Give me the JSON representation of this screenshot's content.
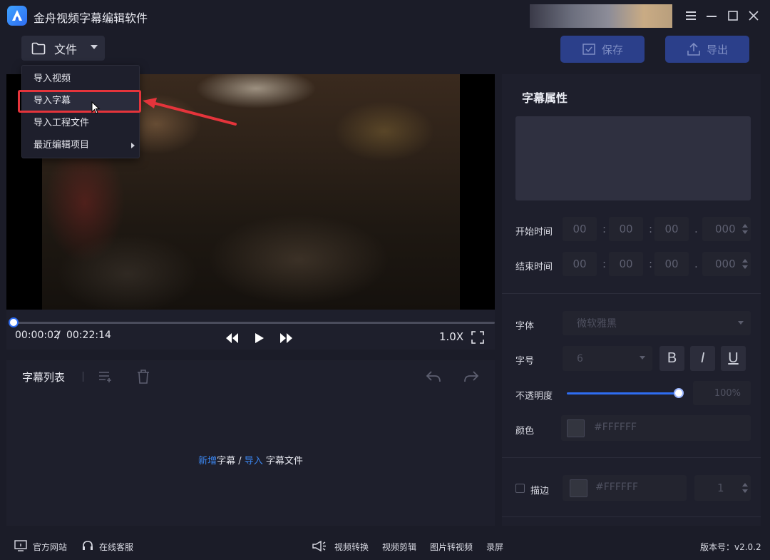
{
  "window": {
    "title": "金舟视频字幕编辑软件",
    "controls": [
      "menu-icon",
      "minimize-icon",
      "maximize-icon",
      "close-icon"
    ]
  },
  "toolbar": {
    "file_label": "文件",
    "save_label": "保存",
    "export_label": "导出"
  },
  "file_menu": {
    "items": [
      {
        "label": "导入视频"
      },
      {
        "label": "导入字幕",
        "highlighted": true
      },
      {
        "label": "导入工程文件"
      },
      {
        "label": "最近编辑项目",
        "has_submenu": true
      }
    ]
  },
  "player": {
    "current_time": "00:00:02",
    "separator": "/",
    "total_time": "00:22:14",
    "speed": "1.0X",
    "progress": 0.0
  },
  "subtitle_list": {
    "title": "字幕列表",
    "empty_hint": {
      "add_link": "新增",
      "add_text": "字幕 / ",
      "import_link": "导入",
      "import_text": " 字幕文件"
    }
  },
  "properties": {
    "title": "字幕属性",
    "start_label": "开始时间",
    "end_label": "结束时间",
    "start_time": {
      "h": "00",
      "m": "00",
      "s": "00",
      "ms": "000"
    },
    "end_time": {
      "h": "00",
      "m": "00",
      "s": "00",
      "ms": "000"
    },
    "font_label": "字体",
    "font_value": "微软雅黑",
    "size_label": "字号",
    "size_value": "6",
    "bold": "B",
    "italic": "I",
    "underline": "U",
    "opacity_label": "不透明度",
    "opacity_value": "100%",
    "opacity": 1.0,
    "color_label": "颜色",
    "color_value": "#FFFFFF",
    "stroke_label": "描边",
    "stroke_color": "#FFFFFF",
    "stroke_width": "1",
    "colon": ":",
    "dot": "."
  },
  "footer": {
    "website": "官方网站",
    "support": "在线客服",
    "video_convert": "视频转换",
    "video_edit": "视频剪辑",
    "image_to_video": "图片转视频",
    "record": "录屏",
    "version": "版本号：v2.0.2"
  },
  "colors": {
    "accent": "#2f6df2",
    "link": "#3b86f0",
    "highlight_border": "#e5343b",
    "background": "#1b1c28"
  }
}
